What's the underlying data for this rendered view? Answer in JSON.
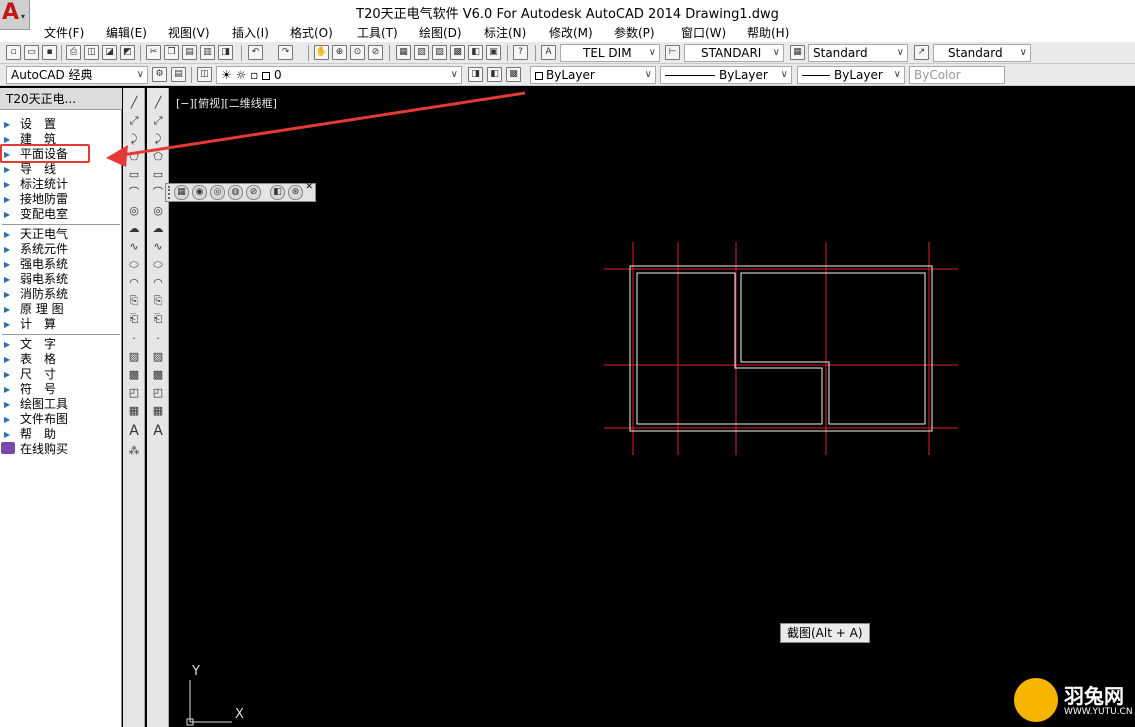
{
  "window": {
    "title": "T20天正电气软件 V6.0 For Autodesk AutoCAD 2014    Drawing1.dwg"
  },
  "menu": [
    {
      "label": "文件(F)"
    },
    {
      "label": "编辑(E)"
    },
    {
      "label": "视图(V)"
    },
    {
      "label": "插入(I)"
    },
    {
      "label": "格式(O)"
    },
    {
      "label": "工具(T)"
    },
    {
      "label": "绘图(D)"
    },
    {
      "label": "标注(N)"
    },
    {
      "label": "修改(M)"
    },
    {
      "label": "参数(P)"
    },
    {
      "label": "窗口(W)"
    },
    {
      "label": "帮助(H)"
    }
  ],
  "toolbar": {
    "text_style": "TEL DIM",
    "dim_style": "STANDARI",
    "table_style": "Standard",
    "multileader_style": "Standard",
    "workspace": "AutoCAD 经典",
    "layer": "0",
    "color": "ByLayer",
    "linetype": "ByLayer",
    "lineweight": "ByLayer",
    "plot_style": "ByColor"
  },
  "sidebar": {
    "title": "T20天正电...",
    "items": [
      {
        "label": "设　置"
      },
      {
        "label": "建　筑"
      },
      {
        "label": "平面设备"
      },
      {
        "label": "导　线"
      },
      {
        "label": "标注统计"
      },
      {
        "label": "接地防雷"
      },
      {
        "label": "变配电室"
      },
      {
        "label": "天正电气"
      },
      {
        "label": "系统元件"
      },
      {
        "label": "强电系统"
      },
      {
        "label": "弱电系统"
      },
      {
        "label": "消防系统"
      },
      {
        "label": "原 理 图"
      },
      {
        "label": "计　算"
      },
      {
        "label": "文　字"
      },
      {
        "label": "表　格"
      },
      {
        "label": "尺　寸"
      },
      {
        "label": "符　号"
      },
      {
        "label": "绘图工具"
      },
      {
        "label": "文件布图"
      },
      {
        "label": "帮　助"
      },
      {
        "label": "在线购买"
      }
    ]
  },
  "viewport": {
    "label": "[−][俯视][二维线框]"
  },
  "tooltip": "截图(Alt + A)",
  "ucs": {
    "y": "Y",
    "x": "X"
  },
  "watermark": {
    "text": "羽兔网",
    "url": "WWW.YUTU.CN"
  },
  "colors": {
    "highlight": "#e53935",
    "grid": "#e02020",
    "wall": "#f2f2f2",
    "canvas": "#000000"
  }
}
